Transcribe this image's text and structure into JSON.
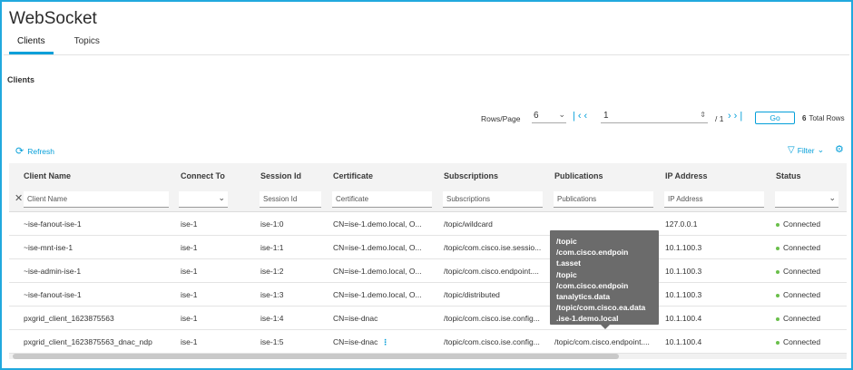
{
  "app": {
    "title": "WebSocket"
  },
  "tabs": [
    {
      "label": "Clients",
      "active": true
    },
    {
      "label": "Topics",
      "active": false
    }
  ],
  "section": {
    "title": "Clients"
  },
  "pagination": {
    "rows_label": "Rows/Page",
    "rows_value": "6",
    "page_value": "1",
    "of_total": "/ 1",
    "go_label": "Go",
    "total_count": "6",
    "total_label": "Total Rows"
  },
  "toolbar": {
    "refresh_label": "Refresh",
    "filter_label": "Filter"
  },
  "table": {
    "columns": [
      "Client Name",
      "Connect To",
      "Session Id",
      "Certificate",
      "Subscriptions",
      "Publications",
      "IP Address",
      "Status"
    ],
    "filter_placeholders": [
      "Client Name",
      "",
      "Session Id",
      "Certificate",
      "Subscriptions",
      "Publications",
      "IP Address",
      ""
    ],
    "rows": [
      [
        "~ise-fanout-ise-1",
        "ise-1",
        "ise-1:0",
        "CN=ise-1.demo.local, O...",
        "/topic/wildcard",
        "",
        "127.0.0.1",
        "Connected"
      ],
      [
        "~ise-mnt-ise-1",
        "ise-1",
        "ise-1:1",
        "CN=ise-1.demo.local, O...",
        "/topic/com.cisco.ise.sessio...",
        "",
        "10.1.100.3",
        "Connected"
      ],
      [
        "~ise-admin-ise-1",
        "ise-1",
        "ise-1:2",
        "CN=ise-1.demo.local, O...",
        "/topic/com.cisco.endpoint....",
        "",
        "10.1.100.3",
        "Connected"
      ],
      [
        "~ise-fanout-ise-1",
        "ise-1",
        "ise-1:3",
        "CN=ise-1.demo.local, O...",
        "/topic/distributed",
        "",
        "10.1.100.3",
        "Connected"
      ],
      [
        "pxgrid_client_1623875563",
        "ise-1",
        "ise-1:4",
        "CN=ise-dnac",
        "/topic/com.cisco.ise.config...",
        "",
        "10.1.100.4",
        "Connected"
      ],
      [
        "pxgrid_client_1623875563_dnac_ndp",
        "ise-1",
        "ise-1:5",
        "CN=ise-dnac",
        "/topic/com.cisco.ise.config...",
        "/topic/com.cisco.endpoint....",
        "10.1.100.4",
        "Connected"
      ]
    ]
  },
  "tooltip": {
    "lines": [
      "/topic",
      "/com.cisco.endpoin",
      "t.asset",
      "/topic",
      "/com.cisco.endpoin",
      "tanalytics.data",
      "/topic/com.cisco.ea.data",
      ".ise-1.demo.local"
    ]
  },
  "colors": {
    "accent": "#049fd9",
    "frame": "#21a9de",
    "status_ok": "#6abf4b",
    "tooltip_bg": "#6b6b6b"
  }
}
